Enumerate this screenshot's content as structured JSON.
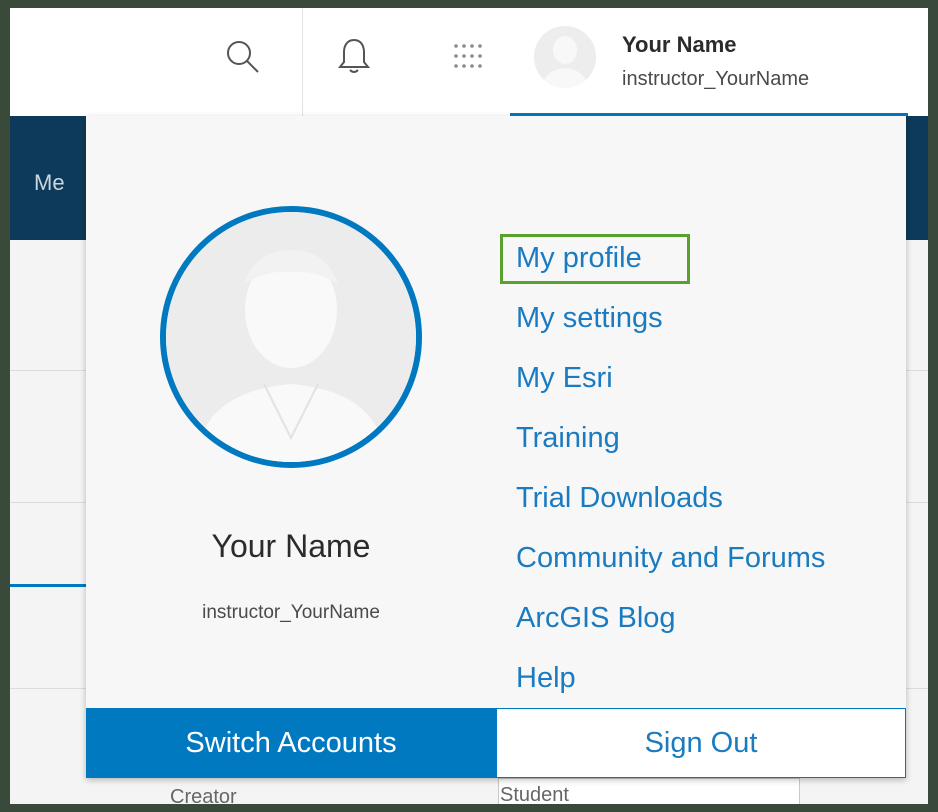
{
  "header": {
    "user_name": "Your Name",
    "username": "instructor_YourName",
    "icons": [
      "search-icon",
      "bell-icon",
      "apps-grid-icon"
    ]
  },
  "background": {
    "nav_partial": "Me",
    "creator_partial": "Creator",
    "student_partial": "Student"
  },
  "dropdown": {
    "user_name": "Your Name",
    "username": "instructor_YourName",
    "links": [
      "My profile",
      "My settings",
      "My Esri",
      "Training",
      "Trial Downloads",
      "Community and Forums",
      "ArcGIS Blog",
      "Help"
    ],
    "highlighted_link": "My profile",
    "switch_accounts": "Switch Accounts",
    "sign_out": "Sign Out"
  },
  "colors": {
    "accent": "#0079c1",
    "link": "#1a7bc0",
    "highlight": "#5aa02c",
    "nav": "#0d3a5a"
  }
}
